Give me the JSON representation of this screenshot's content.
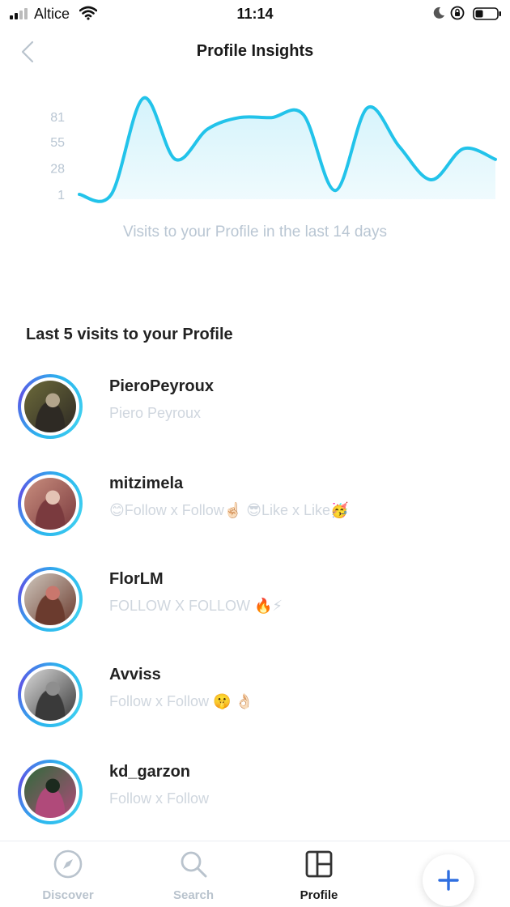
{
  "status_bar": {
    "carrier": "Altice",
    "time": "11:14",
    "icons": [
      "signal-icon",
      "wifi-icon",
      "moon-icon",
      "rotation-lock-icon",
      "battery-icon"
    ]
  },
  "header": {
    "title": "Profile Insights",
    "back_icon": "chevron-left-icon"
  },
  "chart": {
    "caption": "Visits to your Profile in the last 14 days",
    "line_color": "#22c3ea",
    "fill_color": "#d4f3fb"
  },
  "chart_data": {
    "type": "area",
    "ytick_labels": [
      "81",
      "55",
      "28",
      "1"
    ],
    "grid": false,
    "legend": "none",
    "series": [
      {
        "x": [
          1,
          2,
          3,
          4,
          5,
          6,
          7,
          8,
          9,
          10,
          11,
          12,
          13,
          14
        ],
        "values": [
          1,
          1,
          100,
          37,
          68,
          80,
          80,
          83,
          5,
          90,
          50,
          16,
          48,
          37
        ]
      }
    ],
    "ylim": [
      1,
      81
    ]
  },
  "visits": {
    "title": "Last 5 visits to your Profile",
    "items": [
      {
        "username": "PieroPeyroux",
        "subtitle": "Piero Peyroux",
        "photo_colors": [
          "#6c6a3a",
          "#2e2a24",
          "#b3a58c"
        ]
      },
      {
        "username": "mitzimela",
        "subtitle": "😊Follow x Follow☝🏻 😎Like x Like🥳",
        "photo_colors": [
          "#c98e7e",
          "#7a3a3e",
          "#e4c3b4"
        ]
      },
      {
        "username": "FlorLM",
        "subtitle": "FOLLOW  X FOLLOW 🔥⚡",
        "photo_colors": [
          "#cfc7bd",
          "#6b3b2e",
          "#c9776d"
        ]
      },
      {
        "username": "Avviss",
        "subtitle": "Follow x Follow 🤫 👌🏻",
        "photo_colors": [
          "#d9d9d9",
          "#3a3a3a",
          "#8e8e8e"
        ]
      },
      {
        "username": "kd_garzon",
        "subtitle": "Follow x Follow",
        "photo_colors": [
          "#2e6b3a",
          "#b04a7a",
          "#1c2a1e"
        ]
      }
    ]
  },
  "tab_bar": {
    "tabs": [
      {
        "label": "Discover",
        "icon": "compass-icon",
        "active": false
      },
      {
        "label": "Search",
        "icon": "search-icon",
        "active": false
      },
      {
        "label": "Profile",
        "icon": "profile-grid-icon",
        "active": true
      }
    ],
    "fab_icon": "plus-icon",
    "accent": "#2f6fe0"
  }
}
